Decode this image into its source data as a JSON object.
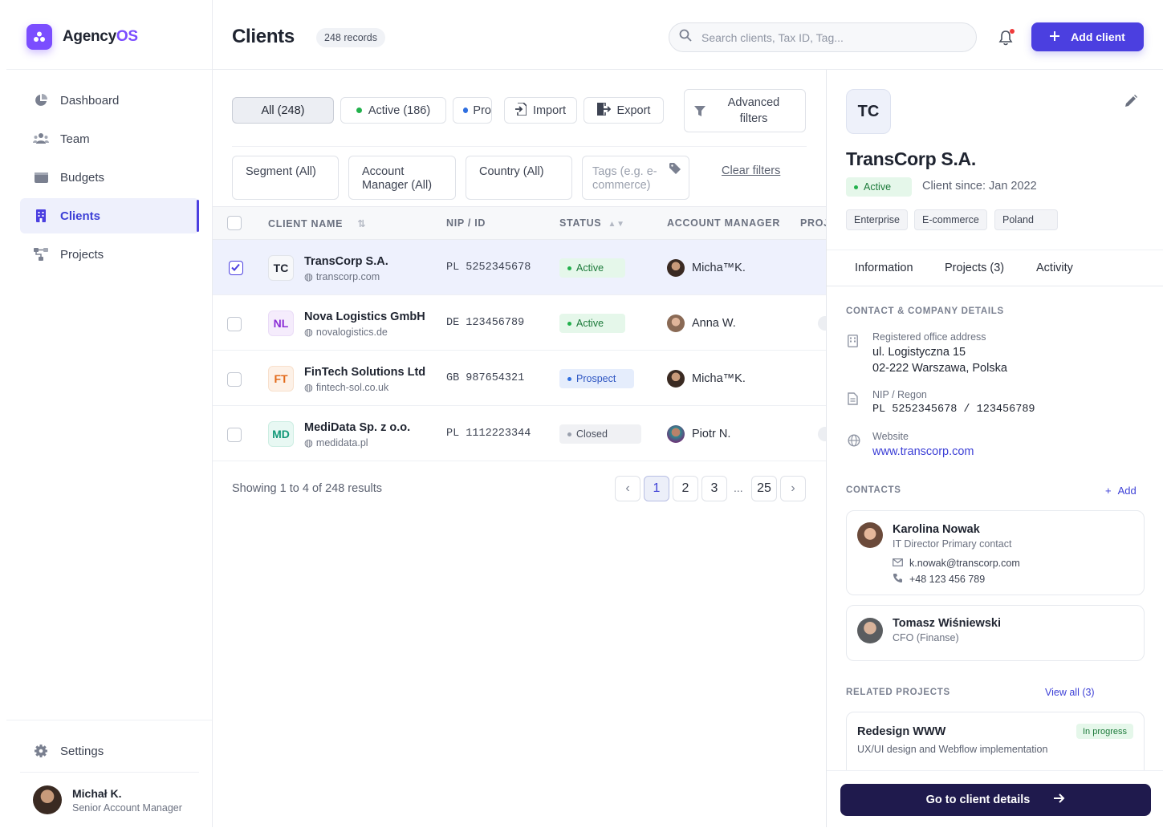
{
  "app": {
    "name_main": "Agency",
    "name_accent": "OS"
  },
  "sidebar": {
    "items": [
      {
        "label": "Dashboard",
        "icon": "pie-chart-icon"
      },
      {
        "label": "Team",
        "icon": "users-icon"
      },
      {
        "label": "Budgets",
        "icon": "wallet-icon"
      },
      {
        "label": "Clients",
        "icon": "building-icon",
        "active": true
      },
      {
        "label": "Projects",
        "icon": "hierarchy-icon"
      }
    ],
    "settings_label": "Settings",
    "user": {
      "name": "Michał K.",
      "role": "Senior Account Manager"
    }
  },
  "header": {
    "title": "Clients",
    "records": "248 records",
    "search_placeholder": "Search clients, Tax ID, Tag...",
    "add_label": "Add client"
  },
  "toolbar": {
    "tab_all": "All (248)",
    "tab_active": "Active (186)",
    "tab_prospect": "Pro",
    "import_label": "Import",
    "export_label": "Export",
    "advanced_label": "Advanced filters"
  },
  "filters": {
    "segment": "Segment (All)",
    "manager": "Account Manager (All)",
    "country": "Country (All)",
    "tags_placeholder": "Tags (e.g. e-commerce)",
    "clear": "Clear filters"
  },
  "table": {
    "columns": [
      "CLIENT NAME",
      "NIP / ID",
      "STATUS",
      "ACCOUNT MANAGER",
      "PROJ"
    ],
    "rows": [
      {
        "initials": "TC",
        "name": "TransCorp S.A.",
        "site": "transcorp.com",
        "nip": "PL 5252345678",
        "status": "Active",
        "manager": "Micha™K.",
        "selected": true
      },
      {
        "initials": "NL",
        "name": "Nova Logistics GmbH",
        "site": "novalogistics.de",
        "nip": "DE 123456789",
        "status": "Active",
        "manager": "Anna W."
      },
      {
        "initials": "FT",
        "name": "FinTech Solutions Ltd",
        "site": "fintech-sol.co.uk",
        "nip": "GB 987654321",
        "status": "Prospect",
        "manager": "Micha™K."
      },
      {
        "initials": "MD",
        "name": "MediData Sp. z o.o.",
        "site": "medidata.pl",
        "nip": "PL 1112223344",
        "status": "Closed",
        "manager": "Piotr N."
      }
    ]
  },
  "pagination": {
    "summary": "Showing 1 to 4 of 248 results",
    "pages": [
      "1",
      "2",
      "3",
      "25"
    ],
    "ellipsis": "...",
    "current": "1"
  },
  "detail": {
    "initials": "TC",
    "name": "TransCorp S.A.",
    "status": "Active",
    "since": "Client since: Jan 2022",
    "tags": [
      "Enterprise",
      "E-commerce",
      "Poland"
    ],
    "tabs": [
      "Information",
      "Projects (3)",
      "Activity"
    ],
    "contact_heading": "CONTACT & COMPANY DETAILS",
    "address_label": "Registered office address",
    "address_line1": "ul. Logistyczna 15",
    "address_line2": "02-222 Warszawa, Polska",
    "nip_label": "NIP / Regon",
    "nip_value": "PL 5252345678 / 123456789",
    "website_label": "Website",
    "website_value": "www.transcorp.com",
    "contacts_heading": "CONTACTS",
    "add_label": "Add",
    "contacts": [
      {
        "name": "Karolina Nowak",
        "role": "IT Director Primary contact",
        "email": "k.nowak@transcorp.com",
        "phone": "+48 123 456 789"
      },
      {
        "name": "Tomasz Wiśniewski",
        "role": "CFO (Finanse)"
      }
    ],
    "projects_heading": "RELATED PROJECTS",
    "view_all": "View all (3)",
    "project": {
      "name": "Redesign WWW",
      "badge": "In progress",
      "desc": "UX/UI design and Webflow implementation"
    },
    "go_label": "Go to client details"
  },
  "colors": {
    "accent": "#4b3fe0",
    "brand": "#7b4dff",
    "dark_button": "#1f1a4d",
    "active_green": "#1c7a3a"
  }
}
